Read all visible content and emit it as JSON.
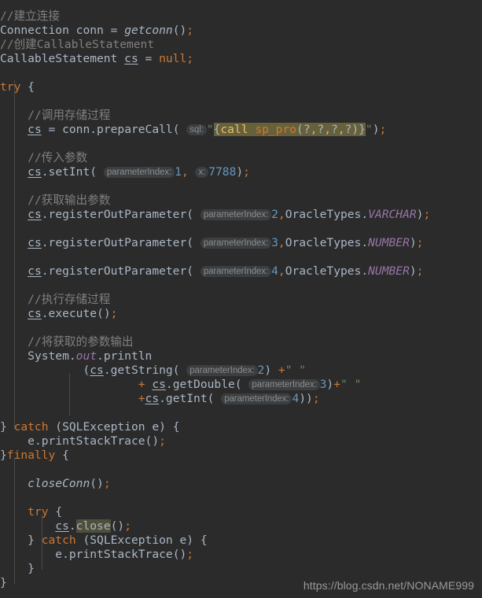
{
  "editor": {
    "theme": "darcula",
    "background": "#2b2b2b",
    "default_text_color": "#a9b7c6",
    "keyword_color": "#cc7832",
    "comment_color": "#808080",
    "number_color": "#6897bb",
    "string_color": "#6a8759",
    "static_field_color": "#9876aa",
    "inlay_hint_color": "#8c8c8c",
    "inlay_hint_background": "#3c3f41",
    "sql_injection_background": "#67613b",
    "identifier_highlight_background": "#4f503b"
  },
  "watermark": {
    "text": "https://blog.csdn.net/NONAME999"
  },
  "code": {
    "language": "java",
    "lines": [
      "//建立连接",
      "Connection conn = getconn();",
      "//创建CallableStatement",
      "CallableStatement cs = null;",
      "",
      "try {",
      "",
      "    //调用存储过程",
      "    cs = conn.prepareCall( sql: \"{call sp_pro(?,?,?,?)}\");",
      "",
      "    //传入参数",
      "    cs.setInt( parameterIndex: 1, x: 7788);",
      "",
      "    //获取输出参数",
      "    cs.registerOutParameter( parameterIndex: 2,OracleTypes.VARCHAR);",
      "",
      "    cs.registerOutParameter( parameterIndex: 3,OracleTypes.NUMBER);",
      "",
      "    cs.registerOutParameter( parameterIndex: 4,OracleTypes.NUMBER);",
      "",
      "    //执行存储过程",
      "    cs.execute();",
      "",
      "    //将获取的参数输出",
      "    System.out.println",
      "            (cs.getString( parameterIndex: 2) +\" \"",
      "                    + cs.getDouble( parameterIndex: 3)+\" \"",
      "                    +cs.getInt( parameterIndex: 4));",
      "",
      "} catch (SQLException e) {",
      "    e.printStackTrace();",
      "}finally {",
      "",
      "    closeConn();",
      "",
      "    try {",
      "        cs.close();",
      "    } catch (SQLException e) {",
      "        e.printStackTrace();",
      "    }",
      "}"
    ],
    "tokens": {
      "comment_connect": "//建立连接",
      "comment_create_cs": "//创建CallableStatement",
      "comment_call_proc": "//调用存储过程",
      "comment_pass_params": "//传入参数",
      "comment_get_out_params": "//获取输出参数",
      "comment_exec_proc": "//执行存储过程",
      "comment_print_params": "//将获取的参数输出",
      "type_connection": "Connection",
      "var_conn": "conn",
      "method_getconn": "getconn",
      "type_callablestatement": "CallableStatement",
      "var_cs": "cs",
      "kw_null": "null",
      "kw_try": "try",
      "kw_catch": "catch",
      "kw_finally": "finally",
      "method_preparecall": "prepareCall",
      "hint_sql": "sql:",
      "sql_string": "{call sp_pro(?,?,?,?)}",
      "sql_kw_call": "call",
      "sql_proc_name": "sp_pro",
      "sql_args": "(?,?,?,?)",
      "sql_brace_open": "{",
      "sql_brace_close": "}",
      "method_setint": "setInt",
      "hint_parameterindex": "parameterIndex:",
      "hint_x": "x:",
      "num_1": "1",
      "num_2": "2",
      "num_3": "3",
      "num_4": "4",
      "num_7788": "7788",
      "method_registeroutparameter": "registerOutParameter",
      "class_oracletypes": "OracleTypes",
      "const_varchar": "VARCHAR",
      "const_number": "NUMBER",
      "method_execute": "execute",
      "class_system": "System",
      "field_out": "out",
      "method_println": "println",
      "method_getstring": "getString",
      "method_getdouble": "getDouble",
      "method_getint": "getInt",
      "str_space": "\" \"",
      "type_sqlexception": "SQLException",
      "var_e": "e",
      "method_printstacktrace": "printStackTrace",
      "method_closeconn": "closeConn",
      "method_close": "close"
    }
  }
}
